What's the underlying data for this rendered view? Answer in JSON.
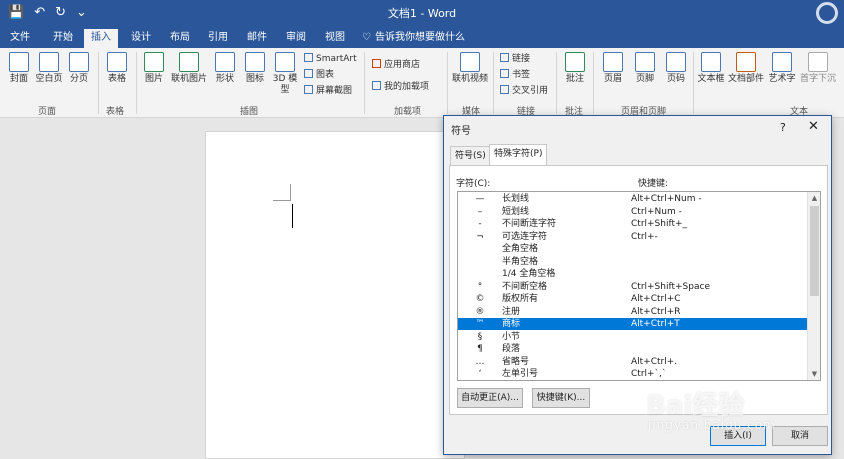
{
  "titlebar": {
    "title": "文档1 - Word",
    "save_icon": "💾",
    "undo_icon": "↶",
    "redo_icon": "↻",
    "more_icon": "⌄"
  },
  "tabs": [
    "文件",
    "开始",
    "插入",
    "设计",
    "布局",
    "引用",
    "邮件",
    "审阅",
    "视图"
  ],
  "active_tab": "插入",
  "tell_me": "告诉我你想要做什么",
  "ribbon": {
    "buttons": {
      "cover": "封面",
      "blank": "空白页",
      "break": "分页",
      "table": "表格",
      "picture": "图片",
      "online_picture": "联机图片",
      "shapes": "形状",
      "icons": "图标",
      "model3d_a": "3D 模",
      "model3d_b": "型",
      "smartart": "SmartArt",
      "chart": "图表",
      "screenshot": "屏幕截图",
      "store": "应用商店",
      "my_addins": "我的加载项",
      "online_video": "联机视频",
      "link": "链接",
      "bookmark": "书签",
      "cross_ref": "交叉引用",
      "comment": "批注",
      "header": "页眉",
      "footer": "页脚",
      "page_number": "页码",
      "textbox": "文本框",
      "quick_parts": "文档部件",
      "wordart": "艺术字",
      "dropcap": "首字下沉"
    },
    "groups": {
      "pages": "页面",
      "tables": "表格",
      "illustrations": "插图",
      "addins": "加载项",
      "media": "媒体",
      "links": "链接",
      "comments": "批注",
      "header_footer": "页眉和页脚",
      "text": "文本"
    }
  },
  "dialog": {
    "title": "符号",
    "help": "?",
    "close": "✕",
    "tabs": [
      "符号(S)",
      "特殊字符(P)"
    ],
    "active_tab": "特殊字符(P)",
    "col_char": "字符(C):",
    "col_key": "快捷键:",
    "rows": [
      {
        "sym": "—",
        "name": "长划线",
        "key": "Alt+Ctrl+Num -"
      },
      {
        "sym": "–",
        "name": "短划线",
        "key": "Ctrl+Num -"
      },
      {
        "sym": "-",
        "name": "不间断连字符",
        "key": "Ctrl+Shift+_"
      },
      {
        "sym": "¬",
        "name": "可选连字符",
        "key": "Ctrl+-"
      },
      {
        "sym": "",
        "name": "全角空格",
        "key": ""
      },
      {
        "sym": "",
        "name": "半角空格",
        "key": ""
      },
      {
        "sym": "",
        "name": "1/4 全角空格",
        "key": ""
      },
      {
        "sym": "°",
        "name": "不间断空格",
        "key": "Ctrl+Shift+Space"
      },
      {
        "sym": "©",
        "name": "版权所有",
        "key": "Alt+Ctrl+C"
      },
      {
        "sym": "®",
        "name": "注册",
        "key": "Alt+Ctrl+R"
      },
      {
        "sym": "™",
        "name": "商标",
        "key": "Alt+Ctrl+T"
      },
      {
        "sym": "§",
        "name": "小节",
        "key": ""
      },
      {
        "sym": "¶",
        "name": "段落",
        "key": ""
      },
      {
        "sym": "…",
        "name": "省略号",
        "key": "Alt+Ctrl+."
      },
      {
        "sym": "‘",
        "name": "左单引号",
        "key": "Ctrl+`,`"
      }
    ],
    "selected_row": "商标",
    "autocorrect": "自动更正(A)...",
    "shortcut": "快捷键(K)...",
    "insert": "插入(I)",
    "cancel": "取消"
  },
  "watermark": {
    "brand": "Bai经验",
    "url": "jingyan.baidu.com"
  }
}
